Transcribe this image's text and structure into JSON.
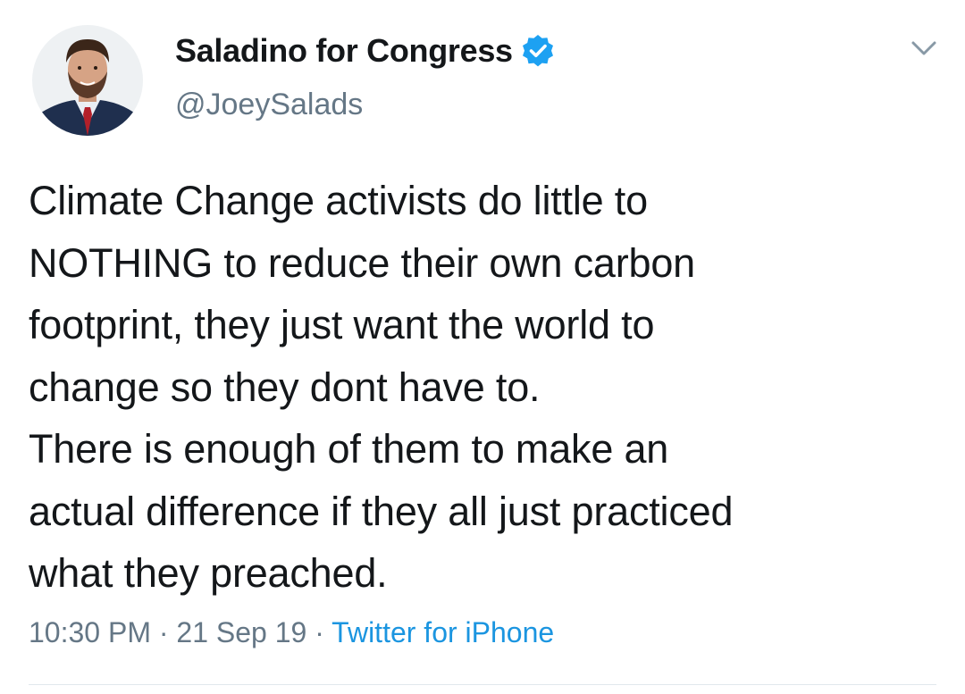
{
  "tweet": {
    "display_name": "Saladino for Congress",
    "handle": "@JoeySalads",
    "verified": true,
    "text": "Climate Change activists do little to\nNOTHING to reduce their own carbon\nfootprint, they just want the world to\nchange so they dont have to.\nThere is enough of them to make an\nactual difference if they all just practiced\nwhat they preached.",
    "time": "10:30 PM",
    "date": "21 Sep 19",
    "source": "Twitter for iPhone",
    "separator": " · "
  },
  "icons": {
    "verified": "verified-badge-icon",
    "menu": "chevron-down-icon",
    "avatar": "profile-photo"
  },
  "colors": {
    "text": "#14171a",
    "secondary": "#657786",
    "link": "#1b95e0",
    "verified": "#1da1f2",
    "divider": "#e1e8ed"
  }
}
